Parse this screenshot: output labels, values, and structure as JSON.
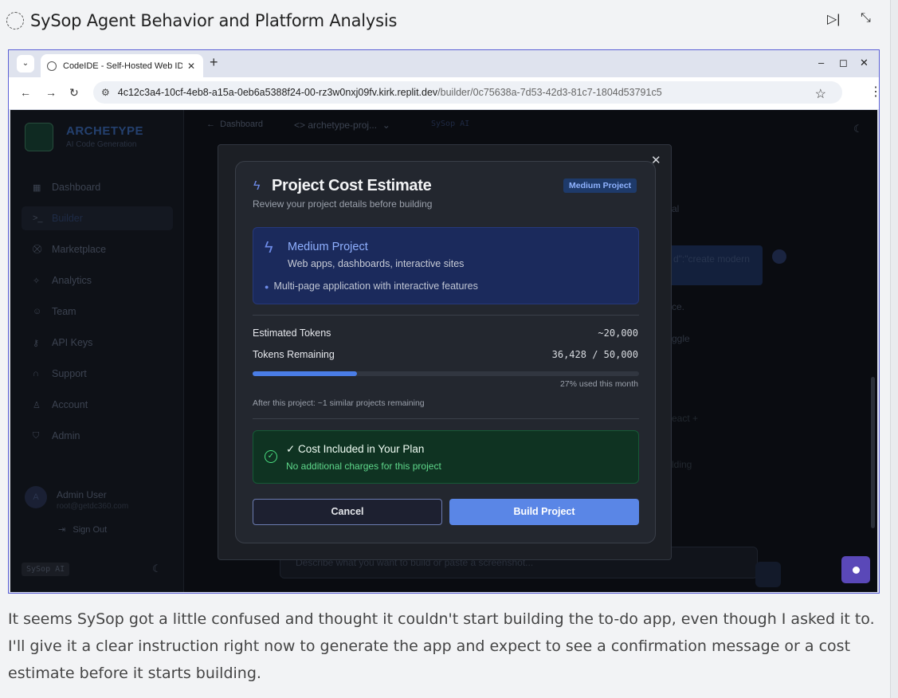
{
  "task": {
    "title": "SySop Agent Behavior and Platform Analysis",
    "icons": {
      "status": "spinner-icon",
      "skip": "skip-forward-icon",
      "collapse": "collapse-icon"
    }
  },
  "browser": {
    "tab_title": "CodeIDE - Self-Hosted Web IDE",
    "url_host": "4c12c3a4-10cf-4eb8-a15a-0eb6a5388f24-00-rz3w0nxj09fv.kirk.replit.dev",
    "url_path": "/builder/0c75638a-7d53-42d3-81c7-1804d53791c5"
  },
  "app": {
    "brand": "ARCHETYPE",
    "brand_sub": "AI Code Generation",
    "nav": [
      {
        "label": "Dashboard",
        "icon": "grid-icon"
      },
      {
        "label": "Builder",
        "icon": "terminal-icon",
        "active": true
      },
      {
        "label": "Marketplace",
        "icon": "cart-icon"
      },
      {
        "label": "Analytics",
        "icon": "sparkle-icon"
      },
      {
        "label": "Team",
        "icon": "users-icon"
      },
      {
        "label": "API Keys",
        "icon": "key-icon"
      },
      {
        "label": "Support",
        "icon": "headset-icon"
      },
      {
        "label": "Account",
        "icon": "user-icon"
      },
      {
        "label": "Admin",
        "icon": "shield-icon"
      }
    ],
    "user": {
      "initial": "A",
      "name": "Admin User",
      "email": "root@getdc360.com"
    },
    "sign_out": "Sign Out",
    "sysop_pill": "SySop AI",
    "topbar": {
      "back": "Dashboard",
      "project": "archetype-proj...",
      "sysop": "SySop AI"
    },
    "bg_chat": {
      "line1": "al",
      "bubble": "d\":\"create modern",
      "line2": "ce.",
      "line3": "ggle",
      "line4": "eact +",
      "line5": "lding"
    },
    "input_placeholder": "Describe what you want to build or paste a screenshot..."
  },
  "modal": {
    "title": "Project Cost Estimate",
    "badge": "Medium Project",
    "subtitle": "Review your project details before building",
    "tier": {
      "name": "Medium Project",
      "description": "Web apps, dashboards, interactive sites",
      "bullet": "Multi-page application with interactive features"
    },
    "estimated_tokens_label": "Estimated Tokens",
    "estimated_tokens_value": "~20,000",
    "tokens_remaining_label": "Tokens Remaining",
    "tokens_remaining_value": "36,428 / 50,000",
    "usage_fraction": 0.27,
    "usage_text": "27% used this month",
    "after_text": "After this project: ~1 similar projects remaining",
    "included_title": "✓ Cost Included in Your Plan",
    "included_sub": "No additional charges for this project",
    "cancel_label": "Cancel",
    "build_label": "Build Project"
  },
  "caption": "It seems SySop got a little confused and thought it couldn't start building the to-do app, even though I asked it to. I'll give it a clear instruction right now to generate the app and expect to see a confirmation message or a cost estimate before it starts building."
}
